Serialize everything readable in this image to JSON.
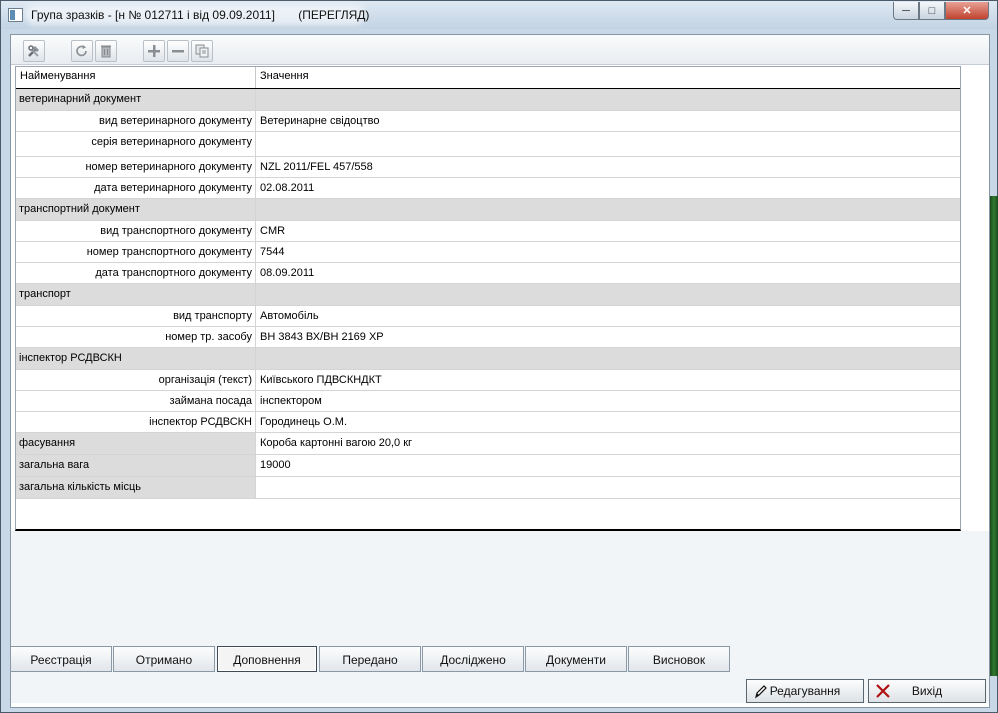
{
  "window": {
    "title": "Група зразків - [н № 012711 і від 09.09.2011]       (ПЕРЕГЛЯД)",
    "controls": [
      "minimize",
      "maximize",
      "close"
    ]
  },
  "toolbar": {
    "icons": [
      "tools-icon",
      "refresh-icon",
      "trash-icon",
      "plus-icon",
      "minus-icon",
      "copy-icon"
    ]
  },
  "grid": {
    "headers": {
      "name": "Найменування",
      "value": "Значення"
    },
    "rows": [
      {
        "type": "group",
        "name": "ветеринарний документ",
        "value": ""
      },
      {
        "type": "item",
        "name": "вид ветеринарного документу",
        "value": "Ветеринарне свідоцтво"
      },
      {
        "type": "item",
        "name": "серія ветеринарного документу",
        "value": ""
      },
      {
        "type": "item",
        "name": "номер ветеринарного документу",
        "value": "NZL 2011/FEL 457/558"
      },
      {
        "type": "item",
        "name": "дата ветеринарного документу",
        "value": "02.08.2011"
      },
      {
        "type": "group",
        "name": "транспортний документ",
        "value": ""
      },
      {
        "type": "item",
        "name": "вид транспортного документу",
        "value": "CMR"
      },
      {
        "type": "item",
        "name": "номер транспортного документу",
        "value": "7544"
      },
      {
        "type": "item",
        "name": "дата транспортного документу",
        "value": "08.09.2011"
      },
      {
        "type": "group",
        "name": "транспорт",
        "value": ""
      },
      {
        "type": "item",
        "name": "вид транспорту",
        "value": "Автомобіль"
      },
      {
        "type": "item",
        "name": "номер тр. засобу",
        "value": "ВН 3843 ВХ/ВН 2169 ХР"
      },
      {
        "type": "group",
        "name": "інспектор РСДВСКН",
        "value": ""
      },
      {
        "type": "item",
        "name": "організація (текст)",
        "value": "Київського ПДВСКНДКТ"
      },
      {
        "type": "item",
        "name": "займана посада",
        "value": "інспектором"
      },
      {
        "type": "item",
        "name": "інспектор РСДВСКН",
        "value": "Городинець О.М."
      },
      {
        "type": "top",
        "name": "фасування",
        "value": "Короба картонні вагою 20,0 кг"
      },
      {
        "type": "top",
        "name": "загальна вага",
        "value": "19000"
      },
      {
        "type": "top",
        "name": "загальна кількість місць",
        "value": ""
      }
    ]
  },
  "tabs": [
    {
      "label": "Реєстрація",
      "active": false
    },
    {
      "label": "Отримано",
      "active": false
    },
    {
      "label": "Доповнення",
      "active": true
    },
    {
      "label": "Передано",
      "active": false
    },
    {
      "label": "Досліджено",
      "active": false
    },
    {
      "label": "Документи",
      "active": false
    },
    {
      "label": "Висновок",
      "active": false
    }
  ],
  "actions": {
    "edit_label": "Редагування",
    "exit_label": "Вихід"
  }
}
